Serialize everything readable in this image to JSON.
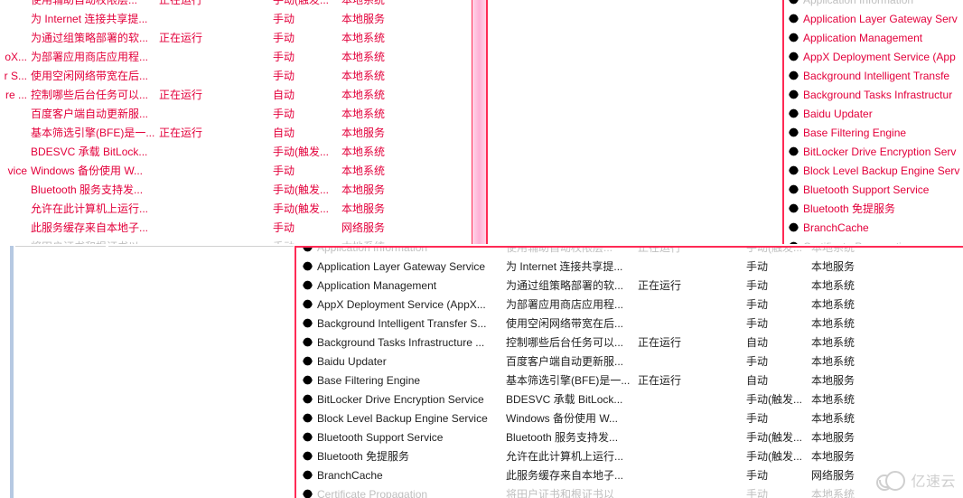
{
  "watermark_text": "亿速云",
  "top_left_header_fragments": [
    "oX...",
    "r S...",
    "re ...",
    "vice"
  ],
  "services_top_left": [
    {
      "left": "",
      "desc": "使用辅助自动权限层...",
      "status": "正在运行",
      "startup": "手动(触发...",
      "logon": "本地系统"
    },
    {
      "left": "",
      "desc": "为 Internet 连接共享提...",
      "status": "",
      "startup": "手动",
      "logon": "本地服务"
    },
    {
      "left": "",
      "desc": "为通过组策略部署的软...",
      "status": "正在运行",
      "startup": "手动",
      "logon": "本地系统"
    },
    {
      "left": "oX...",
      "desc": "为部署应用商店应用程...",
      "status": "",
      "startup": "手动",
      "logon": "本地系统"
    },
    {
      "left": "r S...",
      "desc": "使用空闲网络带宽在后...",
      "status": "",
      "startup": "手动",
      "logon": "本地系统"
    },
    {
      "left": "re ...",
      "desc": "控制哪些后台任务可以...",
      "status": "正在运行",
      "startup": "自动",
      "logon": "本地系统"
    },
    {
      "left": "",
      "desc": "百度客户端自动更新服...",
      "status": "",
      "startup": "手动",
      "logon": "本地系统"
    },
    {
      "left": "",
      "desc": "基本筛选引擎(BFE)是一...",
      "status": "正在运行",
      "startup": "自动",
      "logon": "本地服务"
    },
    {
      "left": "",
      "desc": "BDESVC 承载 BitLock...",
      "status": "",
      "startup": "手动(触发...",
      "logon": "本地系统"
    },
    {
      "left": "vice",
      "desc": "Windows 备份使用 W...",
      "status": "",
      "startup": "手动",
      "logon": "本地系统"
    },
    {
      "left": "",
      "desc": "Bluetooth 服务支持发...",
      "status": "",
      "startup": "手动(触发...",
      "logon": "本地服务"
    },
    {
      "left": "",
      "desc": "允许在此计算机上运行...",
      "status": "",
      "startup": "手动(触发...",
      "logon": "本地服务"
    },
    {
      "left": "",
      "desc": "此服务缓存来自本地子...",
      "status": "",
      "startup": "手动",
      "logon": "网络服务"
    },
    {
      "left": "",
      "desc": "将田户证书和根证书以",
      "status": "",
      "startup": "手动",
      "logon": "本地系统"
    }
  ],
  "services_top_right": [
    "Application Information",
    "Application Layer Gateway Serv",
    "Application Management",
    "AppX Deployment Service (App",
    "Background Intelligent Transfe",
    "Background Tasks Infrastructur",
    "Baidu Updater",
    "Base Filtering Engine",
    "BitLocker Drive Encryption Serv",
    "Block Level Backup Engine Serv",
    "Bluetooth Support Service",
    "Bluetooth 免提服务",
    "BranchCache",
    "Certificate Propagation"
  ],
  "services_bottom": [
    {
      "name": "Application Information",
      "desc": "使用辅助自动权限层...",
      "status": "正在运行",
      "startup": "手动(触发...",
      "logon": "本地系统",
      "faded": true
    },
    {
      "name": "Application Layer Gateway Service",
      "desc": "为 Internet 连接共享提...",
      "status": "",
      "startup": "手动",
      "logon": "本地服务"
    },
    {
      "name": "Application Management",
      "desc": "为通过组策略部署的软...",
      "status": "正在运行",
      "startup": "手动",
      "logon": "本地系统"
    },
    {
      "name": "AppX Deployment Service (AppX...",
      "desc": "为部署应用商店应用程...",
      "status": "",
      "startup": "手动",
      "logon": "本地系统"
    },
    {
      "name": "Background Intelligent Transfer S...",
      "desc": "使用空闲网络带宽在后...",
      "status": "",
      "startup": "手动",
      "logon": "本地系统"
    },
    {
      "name": "Background Tasks Infrastructure ...",
      "desc": "控制哪些后台任务可以...",
      "status": "正在运行",
      "startup": "自动",
      "logon": "本地系统"
    },
    {
      "name": "Baidu Updater",
      "desc": "百度客户端自动更新服...",
      "status": "",
      "startup": "手动",
      "logon": "本地系统"
    },
    {
      "name": "Base Filtering Engine",
      "desc": "基本筛选引擎(BFE)是一...",
      "status": "正在运行",
      "startup": "自动",
      "logon": "本地服务"
    },
    {
      "name": "BitLocker Drive Encryption Service",
      "desc": "BDESVC 承载 BitLock...",
      "status": "",
      "startup": "手动(触发...",
      "logon": "本地系统"
    },
    {
      "name": "Block Level Backup Engine Service",
      "desc": "Windows 备份使用 W...",
      "status": "",
      "startup": "手动",
      "logon": "本地系统"
    },
    {
      "name": "Bluetooth Support Service",
      "desc": "Bluetooth 服务支持发...",
      "status": "",
      "startup": "手动(触发...",
      "logon": "本地服务"
    },
    {
      "name": "Bluetooth 免提服务",
      "desc": "允许在此计算机上运行...",
      "status": "",
      "startup": "手动(触发...",
      "logon": "本地服务"
    },
    {
      "name": "BranchCache",
      "desc": "此服务缓存来自本地子...",
      "status": "",
      "startup": "手动",
      "logon": "网络服务"
    },
    {
      "name": "Certificate Propagation",
      "desc": "将田户证书和根证书以",
      "status": "",
      "startup": "手动",
      "logon": "本地系统",
      "faded": true
    }
  ]
}
